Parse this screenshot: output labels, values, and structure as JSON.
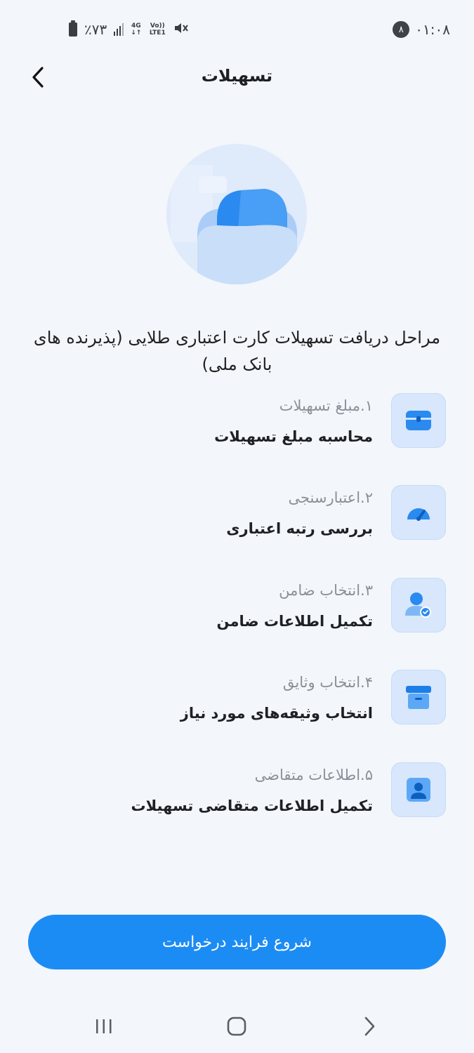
{
  "status_bar": {
    "time": "۰۱:۰۸",
    "notification_count": "۸",
    "battery_text": "٪۷۳",
    "network_4g": "4G",
    "network_volte": "Vo)) LTE1"
  },
  "header": {
    "title": "تسهیلات"
  },
  "intro": {
    "text": "مراحل دریافت تسهیلات کارت اعتباری طلایی (پذیرنده های بانک ملی)"
  },
  "steps": [
    {
      "title": "۱.مبلغ تسهیلات",
      "description": "محاسبه مبلغ تسهیلات",
      "icon": "wallet-icon"
    },
    {
      "title": "۲.اعتبارسنجی",
      "description": "بررسی رتبه اعتباری",
      "icon": "gauge-icon"
    },
    {
      "title": "۳.انتخاب ضامن",
      "description": "تکمیل اطلاعات ضامن",
      "icon": "guarantor-icon"
    },
    {
      "title": "۴.انتخاب وثایق",
      "description": "انتخاب وثیقه‌های مورد نیاز",
      "icon": "archive-box-icon"
    },
    {
      "title": "۵.اطلاعات متقاضی",
      "description": "تکمیل اطلاعات متقاضی تسهیلات",
      "icon": "user-card-icon"
    }
  ],
  "actions": {
    "start_label": "شروع فرایند درخواست"
  },
  "colors": {
    "primary": "#1c8cf5",
    "icon_bg": "#d8e7fb",
    "background": "#f3f6fb"
  }
}
